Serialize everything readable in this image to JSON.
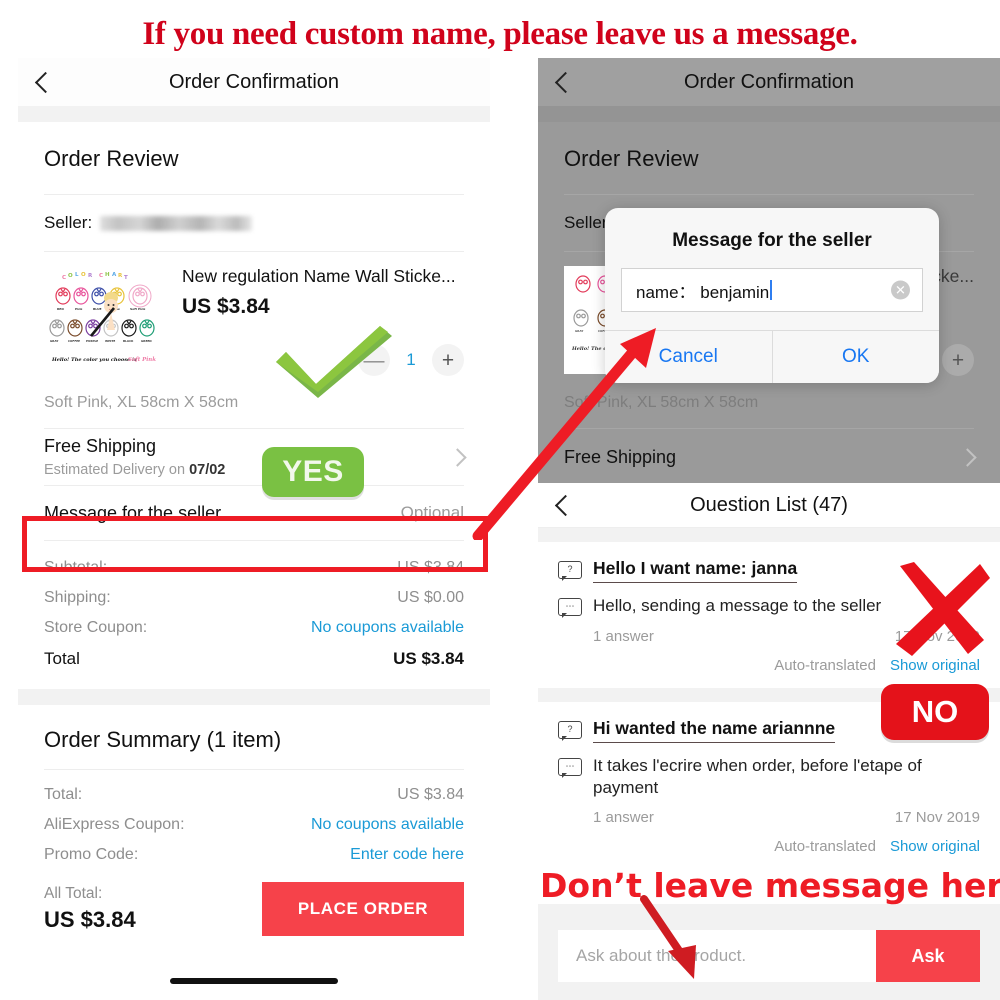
{
  "banner": {
    "text": "If you need custom name, please leave us a message."
  },
  "left": {
    "navbar": {
      "title": "Order Confirmation",
      "back_icon": "chevron-left-icon"
    },
    "order_review_title": "Order Review",
    "seller_label": "Seller:",
    "product": {
      "title": "New regulation Name Wall Sticke...",
      "price": "US $3.84",
      "sku": "Soft Pink, XL 58cm X 58cm",
      "qty": "1",
      "minus": "—",
      "plus": "+",
      "thumb_caption": "Hello! The color you choose is Soft Pink",
      "thumb_header": "COLOR CHART"
    },
    "shipping": {
      "title": "Free Shipping",
      "estimate_prefix": "Estimated Delivery on ",
      "estimate_date": "07/02"
    },
    "message_row": {
      "label": "Message for the seller",
      "value": "Optional"
    },
    "costs": [
      {
        "key": "Subtotal:",
        "value": "US $3.84",
        "link": false
      },
      {
        "key": "Shipping:",
        "value": "US $0.00",
        "link": false
      },
      {
        "key": "Store Coupon:",
        "value": "No coupons available",
        "link": true
      }
    ],
    "total_row": {
      "key": "Total",
      "value": "US $3.84"
    },
    "summary_title": "Order Summary (1 item)",
    "summary_costs": [
      {
        "key": "Total:",
        "value": "US $3.84",
        "link": false
      },
      {
        "key": "AliExpress Coupon:",
        "value": "No coupons available",
        "link": true
      },
      {
        "key": "Promo Code:",
        "value": "Enter code here",
        "link": true
      }
    ],
    "all_total": {
      "label": "All Total:",
      "value": "US $3.84"
    },
    "place_order_button": "PLACE ORDER"
  },
  "right": {
    "navbar": {
      "title": "Order Confirmation",
      "back_icon": "chevron-left-icon"
    },
    "order_review_title": "Order Review",
    "seller_label": "Seller",
    "product": {
      "title": "cke...",
      "sku": "Soft Pink, XL 58cm X 58cm",
      "plus": "+"
    },
    "shipping_title": "Free Shipping",
    "modal": {
      "title": "Message for the seller",
      "input_value": "name： benjamin",
      "clear_icon": "clear-circle-icon",
      "cancel_label": "Cancel",
      "ok_label": "OK"
    },
    "question_list": {
      "navbar_title": "Ouestion List (47)",
      "back_icon": "chevron-left-icon",
      "items": [
        {
          "question": "Hello I want name: janna",
          "answer": "Hello, sending a message to the seller",
          "answer_count": "1 answer",
          "date": "17 Nov 2019",
          "auto_translated": "Auto-translated",
          "show_original": "Show original"
        },
        {
          "question": "Hi wanted the name ariannne",
          "answer": "It takes l'ecrire when order, before l'etape of payment",
          "answer_count": "1 answer",
          "date": "17 Nov 2019",
          "auto_translated": "Auto-translated",
          "show_original": "Show original"
        }
      ],
      "ask_placeholder": "Ask about the product.",
      "ask_button": "Ask"
    }
  },
  "annotations": {
    "yes_badge": "YES",
    "no_badge": "NO",
    "dont_leave_text": "Don’t leave  message here",
    "check_icon": "green-check-icon",
    "x_icon": "red-x-icon",
    "arrow_icon": "red-arrow-icon",
    "redbox_icon": "red-highlight-box"
  },
  "colors": {
    "brand_red": "#f6424a",
    "annotation_red": "#ee1c25",
    "link_blue": "#1a9ad6",
    "dialog_blue": "#1877f2",
    "green": "#7ac143"
  }
}
